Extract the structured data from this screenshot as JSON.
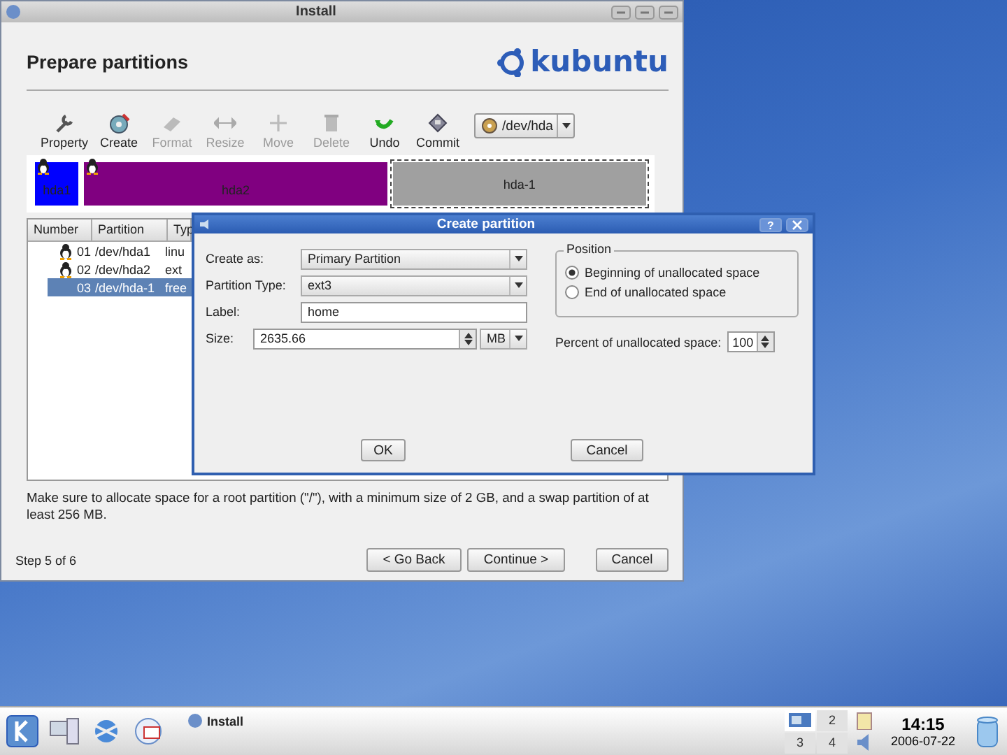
{
  "install_window": {
    "title": "Install",
    "heading": "Prepare partitions",
    "logo_text": "kubuntu",
    "toolbar": [
      {
        "label": "Property",
        "disabled": false
      },
      {
        "label": "Create",
        "disabled": false
      },
      {
        "label": "Format",
        "disabled": true
      },
      {
        "label": "Resize",
        "disabled": true
      },
      {
        "label": "Move",
        "disabled": true
      },
      {
        "label": "Delete",
        "disabled": true
      },
      {
        "label": "Undo",
        "disabled": false
      },
      {
        "label": "Commit",
        "disabled": false
      }
    ],
    "device_select": {
      "value": "/dev/hda"
    },
    "partition_map": [
      {
        "label": "hda1",
        "kind": "linux",
        "color": "#0000ff",
        "selected": false
      },
      {
        "label": "hda2",
        "kind": "linux",
        "color": "#800080",
        "selected": false
      },
      {
        "label": "hda-1",
        "kind": "free",
        "color": "#a0a0a0",
        "selected": true
      }
    ],
    "table": {
      "columns": [
        "Number",
        "Partition",
        "Typ"
      ],
      "rows": [
        {
          "kind": "linux",
          "number": "01",
          "partition": "/dev/hda1",
          "type": "linu",
          "selected": false
        },
        {
          "kind": "linux",
          "number": "02",
          "partition": "/dev/hda2",
          "type": "ext",
          "selected": false
        },
        {
          "kind": "free",
          "number": "03",
          "partition": "/dev/hda-1",
          "type": "free",
          "selected": true
        }
      ]
    },
    "note": "Make sure to allocate space for a root partition (\"/\"), with a minimum size of 2 GB, and a swap partition of at least 256 MB.",
    "step": "Step 5 of 6",
    "buttons": [
      "< Go Back",
      "Continue >",
      "Cancel"
    ]
  },
  "dialog": {
    "title": "Create partition",
    "help_button": "?",
    "fields": [
      {
        "kind": "combo",
        "label": "Create as:",
        "value": "Primary Partition"
      },
      {
        "kind": "combo",
        "label": "Partition Type:",
        "value": "ext3"
      },
      {
        "kind": "text",
        "label": "Label:",
        "value": "home"
      },
      {
        "kind": "spin",
        "label": "Size:",
        "value": "2635.66",
        "unit": "MB"
      }
    ],
    "position": {
      "title": "Position",
      "options": [
        {
          "label": "Beginning of unallocated space",
          "selected": true
        },
        {
          "label": "End of unallocated space",
          "selected": false
        }
      ]
    },
    "percent": {
      "label": "Percent of unallocated space:",
      "value": "100"
    },
    "buttons": [
      "OK",
      "Cancel"
    ]
  },
  "taskbar": {
    "task": "Install",
    "pager": [
      "2",
      "3",
      "4"
    ],
    "time": "14:15",
    "date": "2006-07-22"
  }
}
